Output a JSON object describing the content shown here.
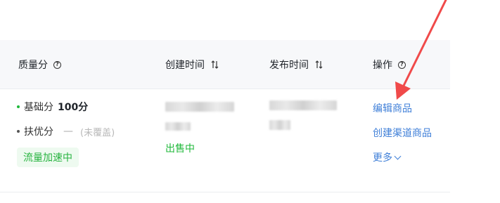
{
  "header": {
    "quality_label": "质量分",
    "created_label": "创建时间",
    "published_label": "发布时间",
    "ops_label": "操作"
  },
  "row": {
    "base_label": "基础分",
    "base_value": "100分",
    "support_label": "扶优分",
    "support_dash": "—",
    "support_status": "(未覆盖)",
    "boost_badge": "流量加速中",
    "status": "出售中",
    "ops": {
      "edit": "编辑商品",
      "create_channel": "创建渠道商品",
      "more": "更多"
    }
  },
  "colors": {
    "accent_link": "#3f7fd8",
    "success": "#1fb83a",
    "annotation_arrow": "#f04a4a"
  }
}
